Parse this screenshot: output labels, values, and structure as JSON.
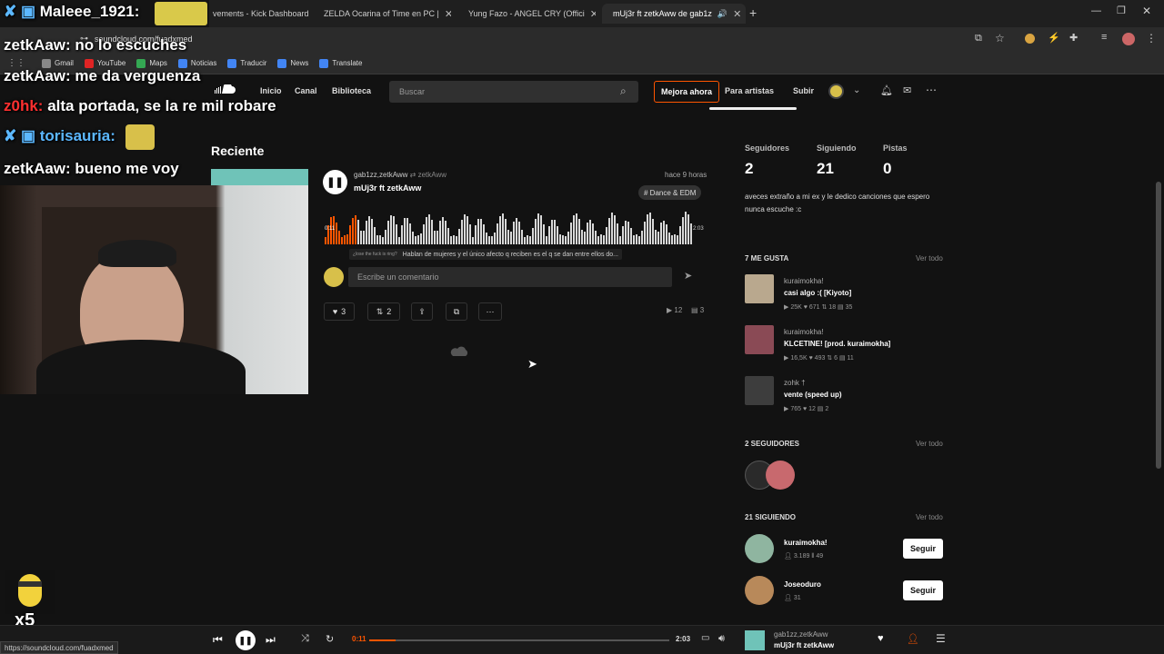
{
  "tabs": [
    {
      "label": "vements - Kick Dashboard"
    },
    {
      "label": "ZELDA Ocarina of Time en PC |"
    },
    {
      "label": "Yung Fazo - ANGEL CRY (Offici"
    },
    {
      "label": "mUj3r ft zetkAww de gab1z"
    }
  ],
  "address": {
    "url": "soundcloud.com/fuadxmed"
  },
  "bookmarks": [
    "Gmail",
    "YouTube",
    "Maps",
    "Noticias",
    "Traducir",
    "News",
    "Translate"
  ],
  "nav": {
    "home": "Inicio",
    "feed": "Canal",
    "library": "Biblioteca",
    "upgrade": "Mejora ahora",
    "artists": "Para artistas",
    "upload": "Subir"
  },
  "search": {
    "placeholder": "Buscar"
  },
  "recent": {
    "title": "Reciente"
  },
  "track": {
    "artists": "gab1zz,zetkAww",
    "reposter": "zetkAww",
    "title": "mUj3r ft zetkAww",
    "time_ago": "hace 9 horas",
    "tag": "# Dance & EDM",
    "elapsed": "0:11",
    "duration": "2:03",
    "progress": 0.089,
    "comment_user": "¿lose the fuck is ring?",
    "comment_text": "Hablan de mujeres y el único afecto q reciben es el q se dan entre ellos do...",
    "comment_placeholder": "Escribe un comentario",
    "likes": "3",
    "reposts": "2",
    "plays": "12",
    "comments": "3"
  },
  "profile": {
    "followers_label": "Seguidores",
    "followers": "2",
    "following_label": "Siguiendo",
    "following": "21",
    "tracks_label": "Pistas",
    "tracks": "0",
    "bio": "aveces extraño a mi ex y le dedico canciones que espero nunca escuche :c"
  },
  "likes_section": {
    "title": "7 ME GUSTA",
    "see_all": "Ver todo",
    "items": [
      {
        "user": "kuraimokha!",
        "title": "casi algo :( [Kiyoto]",
        "plays": "25K",
        "likes": "671",
        "reposts": "18",
        "comments": "35"
      },
      {
        "user": "kuraimokha!",
        "title": "KLCETINE! [prod. kuraimokha]",
        "plays": "16,5K",
        "likes": "493",
        "reposts": "6",
        "comments": "11"
      },
      {
        "user": "zohk †",
        "title": "vente (speed up)",
        "plays": "765",
        "likes": "12",
        "comments": "2"
      }
    ]
  },
  "followers_section": {
    "title": "2 SEGUIDORES",
    "see_all": "Ver todo"
  },
  "following_section": {
    "title": "21 SIGUIENDO",
    "see_all": "Ver todo",
    "items": [
      {
        "user": "kuraimokha!",
        "followers": "3.189",
        "tracks": "49",
        "button": "Seguir"
      },
      {
        "user": "Joseoduro",
        "followers": "31",
        "button": "Seguir"
      }
    ]
  },
  "player": {
    "elapsed": "0:11",
    "duration": "2:03",
    "artist": "gab1zz,zetkAww",
    "title": "mUj3r ft zetkAww"
  },
  "chat": [
    {
      "user": "Maleee_1921:",
      "text": ""
    },
    {
      "user": "zetkAaw:",
      "text": "no lo escuches"
    },
    {
      "user": "zetkAaw:",
      "text": "me da verguenza"
    },
    {
      "user": "z0hk:",
      "text": "alta portada, se la re mil robare"
    },
    {
      "user": "torisauria:",
      "text": ""
    },
    {
      "user": "zetkAaw:",
      "text": "bueno me voy"
    }
  ],
  "overlay": {
    "multiplier": "x5"
  },
  "status_url": "https://soundcloud.com/fuadxmed",
  "colors": {
    "accent": "#ff5500",
    "bg": "#121212"
  }
}
